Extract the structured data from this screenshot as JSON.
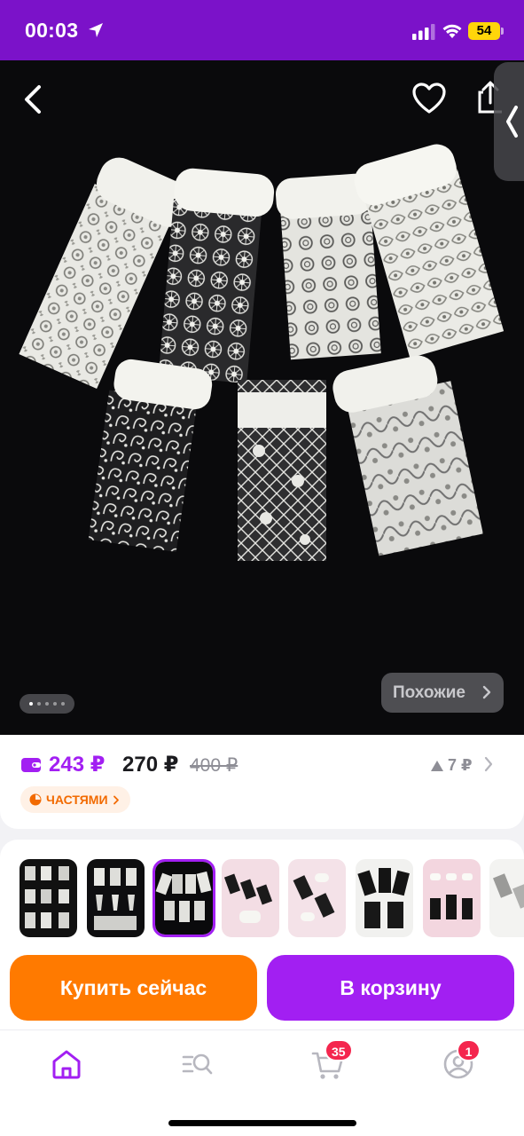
{
  "status_bar": {
    "time": "00:03",
    "battery": "54"
  },
  "hero": {
    "similar_label": "Похожие",
    "page_dots": 5,
    "active_dot": 0
  },
  "price": {
    "card_price": "243 ₽",
    "price": "270 ₽",
    "old_price": "400 ₽",
    "price_drop": "7 ₽",
    "installments_label": "ЧАСТЯМИ"
  },
  "thumbnails": {
    "count": 9,
    "selected_index": 2
  },
  "actions": {
    "buy_now": "Купить сейчас",
    "add_to_cart": "В корзину"
  },
  "nav": {
    "cart_badge": "35",
    "profile_badge": "1"
  },
  "colors": {
    "brand_purple": "#a21ff2",
    "status_purple": "#7b12c9",
    "buy_orange": "#ff7a00",
    "badge_red": "#f4264e"
  }
}
